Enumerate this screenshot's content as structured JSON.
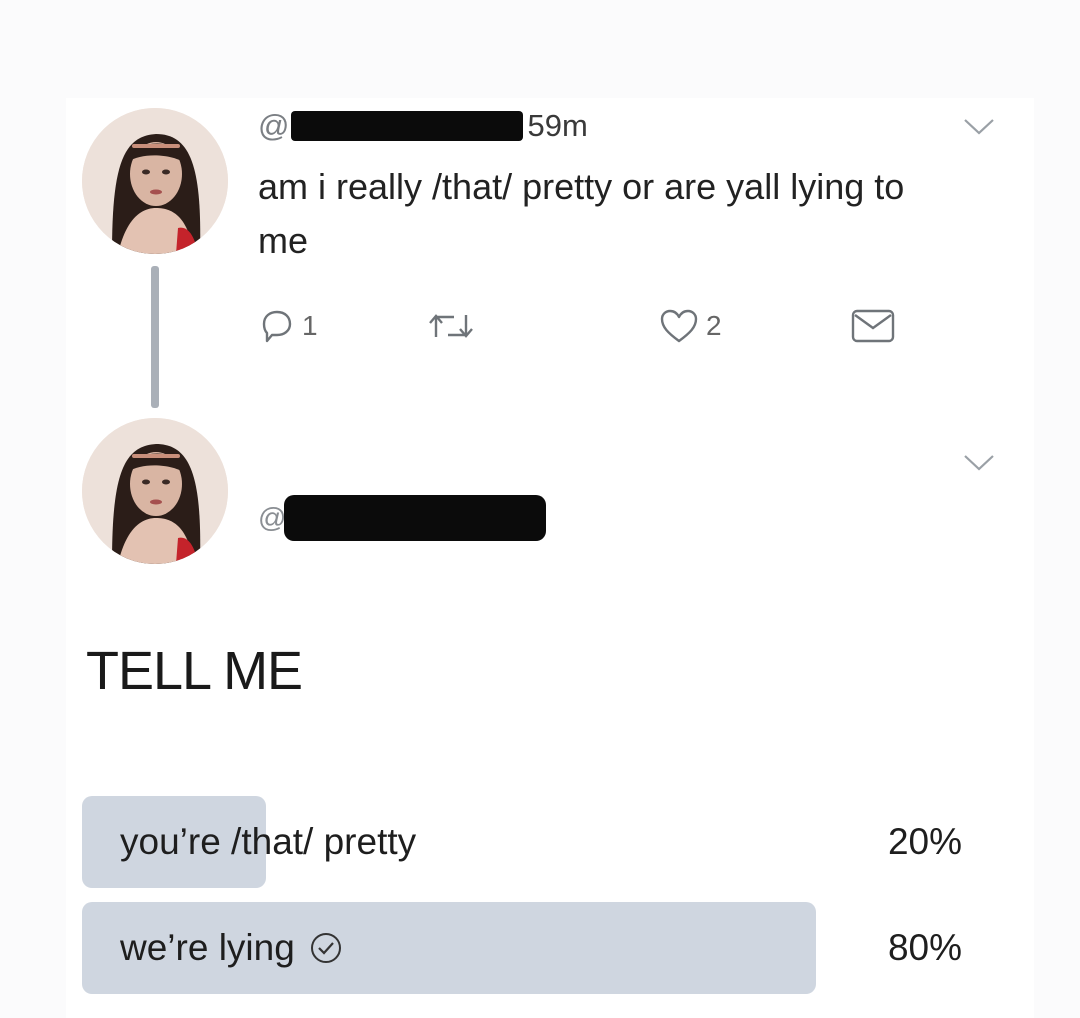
{
  "tweet": {
    "handle_prefix": "@",
    "time": "59m",
    "text": "am i really /that/ pretty or are yall lying to me",
    "reply_count": "1",
    "like_count": "2"
  },
  "reply": {
    "handle_prefix": "@"
  },
  "poll": {
    "question": "TELL ME",
    "options": [
      {
        "label": "you’re /that/ pretty",
        "percent_text": "20%",
        "percent": 20,
        "selected": false
      },
      {
        "label": "we’re lying",
        "percent_text": "80%",
        "percent": 80,
        "selected": true
      }
    ]
  },
  "colors": {
    "poll_fill": "#cfd6e0",
    "thread_line": "#aab0b8",
    "icon_gray": "#6f7479"
  },
  "icons": [
    "chevron-down-icon",
    "reply-icon",
    "retweet-icon",
    "like-icon",
    "message-icon",
    "check-circle-icon"
  ]
}
